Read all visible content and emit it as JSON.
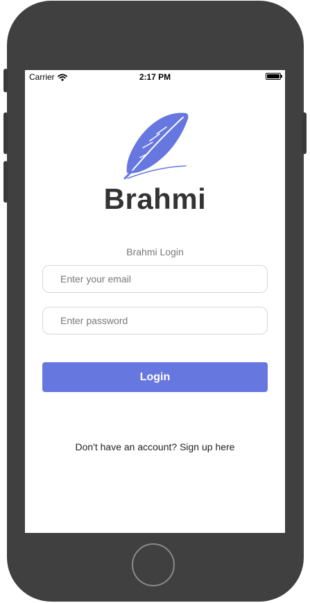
{
  "status_bar": {
    "carrier": "Carrier",
    "time": "2:17 PM"
  },
  "app": {
    "name": "Brahmi",
    "login_heading": "Brahmi Login"
  },
  "form": {
    "email_placeholder": "Enter your email",
    "email_value": "",
    "password_placeholder": "Enter password",
    "password_value": ""
  },
  "actions": {
    "login_label": "Login",
    "signup_text": "Don't have an account? Sign up here"
  },
  "colors": {
    "accent": "#6777e0",
    "device_frame": "#404040",
    "brand_text": "#333333"
  },
  "icons": {
    "logo": "feather-quill-icon",
    "wifi": "wifi-icon",
    "battery": "battery-icon"
  }
}
